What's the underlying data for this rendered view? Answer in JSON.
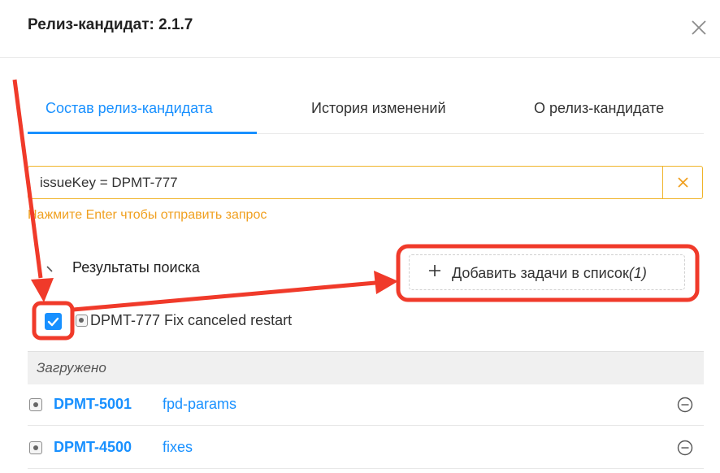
{
  "modal": {
    "title": "Релиз-кандидат: 2.1.7"
  },
  "tabs": [
    {
      "label": "Состав релиз-кандидата",
      "active": true
    },
    {
      "label": "История изменений",
      "active": false
    },
    {
      "label": "О релиз-кандидате",
      "active": false
    }
  ],
  "search": {
    "value": "issueKey = DPMT-777",
    "hint": "Нажмите Enter чтобы отправить запрос"
  },
  "results": {
    "title": "Результаты поиска",
    "add_button": {
      "label": "Добавить задачи в список",
      "count": "(1)"
    },
    "items": [
      {
        "text": "DPMT-777 Fix canceled restart",
        "checked": true
      }
    ]
  },
  "loaded": {
    "title": "Загружено",
    "items": [
      {
        "key": "DPMT-5001",
        "summary": "fpd-params"
      },
      {
        "key": "DPMT-4500",
        "summary": "fixes"
      }
    ]
  },
  "colors": {
    "accent": "#1890ff",
    "warning": "#f0b429",
    "annotation": "#f03a2a"
  },
  "icons": [
    "close-icon",
    "clear-icon",
    "caret-icon",
    "plus-icon",
    "issue-type-icon",
    "remove-icon",
    "check-icon"
  ]
}
